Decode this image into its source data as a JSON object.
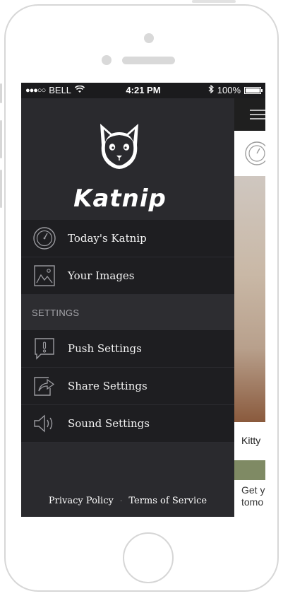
{
  "status_bar": {
    "signal": "●●●○○",
    "carrier": "BELL",
    "time": "4:21 PM",
    "battery": "100%",
    "battery_level": 1.0
  },
  "drawer": {
    "brand": "Katnip",
    "menu": [
      {
        "label": "Today's Katnip",
        "icon": "gauge-icon"
      },
      {
        "label": "Your Images",
        "icon": "image-icon"
      }
    ],
    "settings_header": "SETTINGS",
    "settings": [
      {
        "label": "Push Settings",
        "icon": "notification-icon"
      },
      {
        "label": "Share Settings",
        "icon": "share-icon"
      },
      {
        "label": "Sound Settings",
        "icon": "speaker-icon"
      }
    ],
    "footer": {
      "privacy": "Privacy Policy",
      "separator": "·",
      "terms": "Terms of Service"
    }
  },
  "content": {
    "caption": "Kitty",
    "teaser_line1": "Get y",
    "teaser_line2": "tomo"
  },
  "colors": {
    "drawer_bg": "#2a2a2e",
    "menu_bg": "#1e1e21",
    "section_bg": "#2d2d31"
  }
}
